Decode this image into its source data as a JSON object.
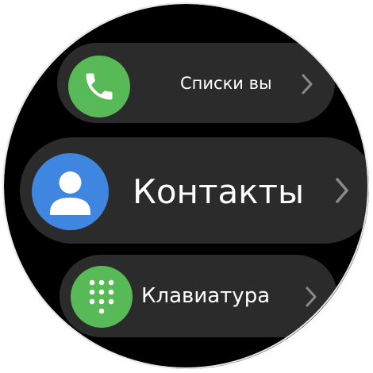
{
  "watch": {
    "items": [
      {
        "id": "call-logs",
        "label": "Списки вы",
        "icon": "phone-handset-icon",
        "icon_color": "#58b957"
      },
      {
        "id": "contacts",
        "label": "Контакты",
        "icon": "person-icon",
        "icon_color": "#3f86e1"
      },
      {
        "id": "keypad",
        "label": "Клавиатура",
        "icon": "dialpad-icon",
        "icon_color": "#58b957"
      }
    ],
    "chevron_icon": "chevron-right-icon",
    "background": "#000000",
    "row_color": "#2b2b2b"
  }
}
